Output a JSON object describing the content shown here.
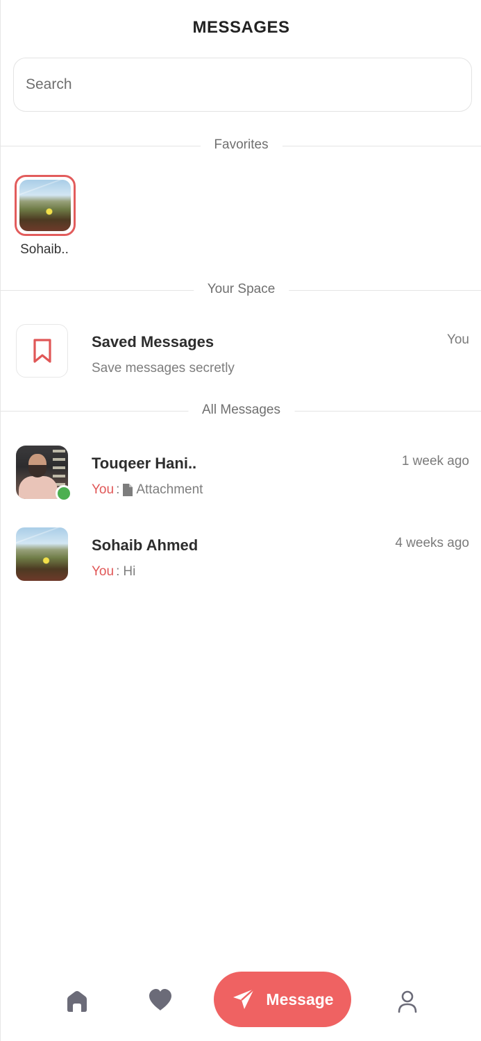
{
  "header": {
    "title": "MESSAGES"
  },
  "search": {
    "placeholder": "Search"
  },
  "sections": {
    "favorites": "Favorites",
    "your_space": "Your Space",
    "all_messages": "All Messages"
  },
  "favorites": [
    {
      "name": "Sohaib..",
      "icon": "landscape-photo"
    }
  ],
  "saved": {
    "title": "Saved Messages",
    "subtitle": "Save messages secretly",
    "owner": "You",
    "icon": "bookmark-icon"
  },
  "conversations": [
    {
      "name": "Touqeer Hani..",
      "time": "1 week ago",
      "sender": "You",
      "separator": ":",
      "preview": "Attachment",
      "preview_icon": "document-icon",
      "online": true
    },
    {
      "name": "Sohaib Ahmed",
      "time": "4 weeks ago",
      "sender": "You",
      "separator": ":",
      "preview": "Hi",
      "online": false
    }
  ],
  "bottom_nav": {
    "home_icon": "home-icon",
    "favorites_icon": "heart-icon",
    "message_label": "Message",
    "message_icon": "send-icon",
    "profile_icon": "user-icon"
  },
  "colors": {
    "accent": "#ef6262",
    "you_text": "#e05757",
    "online": "#4caf50",
    "nav_icon": "#6b6b78"
  }
}
